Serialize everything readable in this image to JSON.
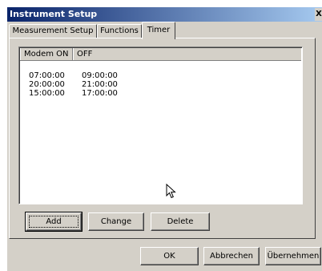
{
  "window": {
    "title": "Instrument Setup",
    "close_label": "X"
  },
  "tabs": [
    {
      "label": "Measurement Setup",
      "active": false
    },
    {
      "label": "Functions",
      "active": false
    },
    {
      "label": "Timer",
      "active": true
    }
  ],
  "timer_list": {
    "columns": [
      "Modem ON",
      "OFF"
    ],
    "rows": [
      {
        "on": "07:00:00",
        "off": "09:00:00"
      },
      {
        "on": "20:00:00",
        "off": "21:00:00"
      },
      {
        "on": "15:00:00",
        "off": "17:00:00"
      }
    ]
  },
  "timer_buttons": {
    "add": "Add",
    "change": "Change",
    "delete": "Delete"
  },
  "dialog_buttons": {
    "ok": "OK",
    "cancel": "Abbrechen",
    "apply": "Übernehmen"
  },
  "colors": {
    "face": "#d4d0c8",
    "title_start": "#0a246a",
    "title_end": "#a6caf0"
  }
}
